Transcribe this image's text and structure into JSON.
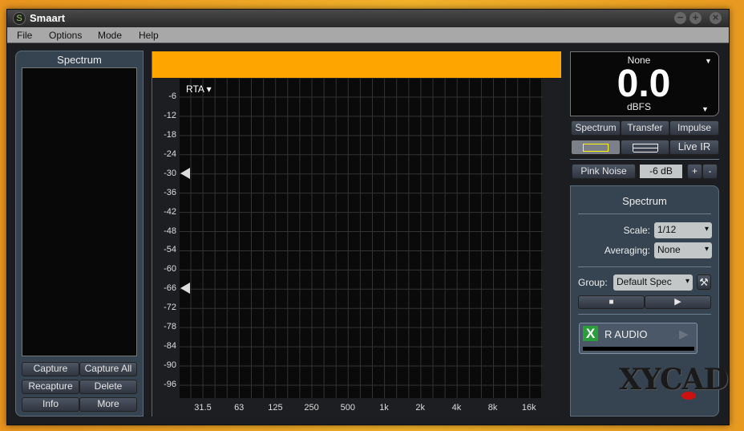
{
  "window": {
    "title": "Smaart",
    "controls": [
      "minimize",
      "maximize",
      "close"
    ]
  },
  "menu": [
    "File",
    "Options",
    "Mode",
    "Help"
  ],
  "left_panel": {
    "title": "Spectrum",
    "buttons": [
      "Capture",
      "Capture All",
      "Recapture",
      "Delete",
      "Info",
      "More"
    ]
  },
  "plot": {
    "mode": "RTA ▾",
    "y_ticks": [
      "-6",
      "-12",
      "-18",
      "-24",
      "-30",
      "-36",
      "-42",
      "-48",
      "-54",
      "-60",
      "-66",
      "-72",
      "-78",
      "-84",
      "-90",
      "-96"
    ],
    "x_ticks": [
      "31.5",
      "63",
      "125",
      "250",
      "500",
      "1k",
      "2k",
      "4k",
      "8k",
      "16k"
    ],
    "banner_color": "#ffa500",
    "markers_db": [
      -30,
      -66
    ]
  },
  "meter": {
    "label": "None",
    "value": "0.0",
    "unit": "dBFS"
  },
  "mode_tabs": [
    "Spectrum",
    "Transfer",
    "Impulse"
  ],
  "view_tabs": {
    "live_ir": "Live IR",
    "active": "single"
  },
  "generator": {
    "label": "Pink Noise",
    "level": "-6 dB",
    "plus": "+",
    "minus": "-"
  },
  "spectrum_panel": {
    "title": "Spectrum",
    "scale_label": "Scale:",
    "scale": "1/12",
    "averaging_label": "Averaging:",
    "averaging": "None",
    "group_label": "Group:",
    "group": "Default Spec",
    "measurement": {
      "name": "R AUDIO",
      "enabled": true
    }
  },
  "watermark": "XYCAD.com"
}
